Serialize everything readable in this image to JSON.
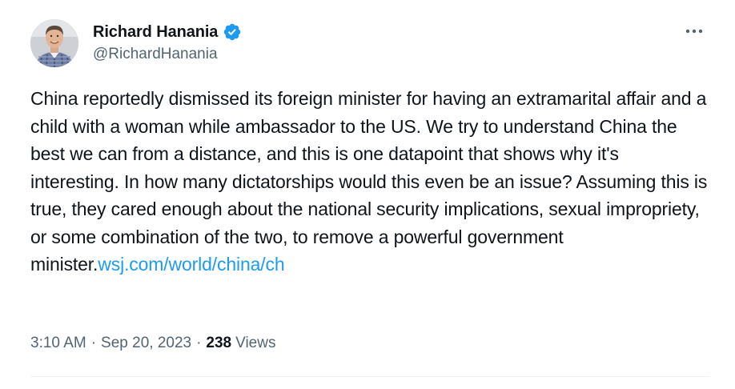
{
  "author": {
    "display_name": "Richard Hanania",
    "handle": "@RichardHanania",
    "verified": true,
    "verified_color": "#1d9bf0"
  },
  "tweet": {
    "text": "China reportedly dismissed its foreign minister for having an extramarital affair and a child with a woman while ambassador to the US. We try to understand China the best we can from a distance, and this is one datapoint that shows why it's interesting. In how many dictatorships would this even be an issue? Assuming this is true, they cared enough about the national security implications, sexual impropriety, or some combination of the two, to remove a powerful government minister.",
    "link_text": "wsj.com/world/china/ch",
    "link_color": "#1d9bf0"
  },
  "meta": {
    "time": "3:10 AM",
    "separator": "·",
    "date": "Sep 20, 2023",
    "views_count": "238",
    "views_label": "Views"
  },
  "icons": {
    "more": "more-options-icon",
    "verified": "verified-badge-icon",
    "avatar": "profile-photo"
  }
}
